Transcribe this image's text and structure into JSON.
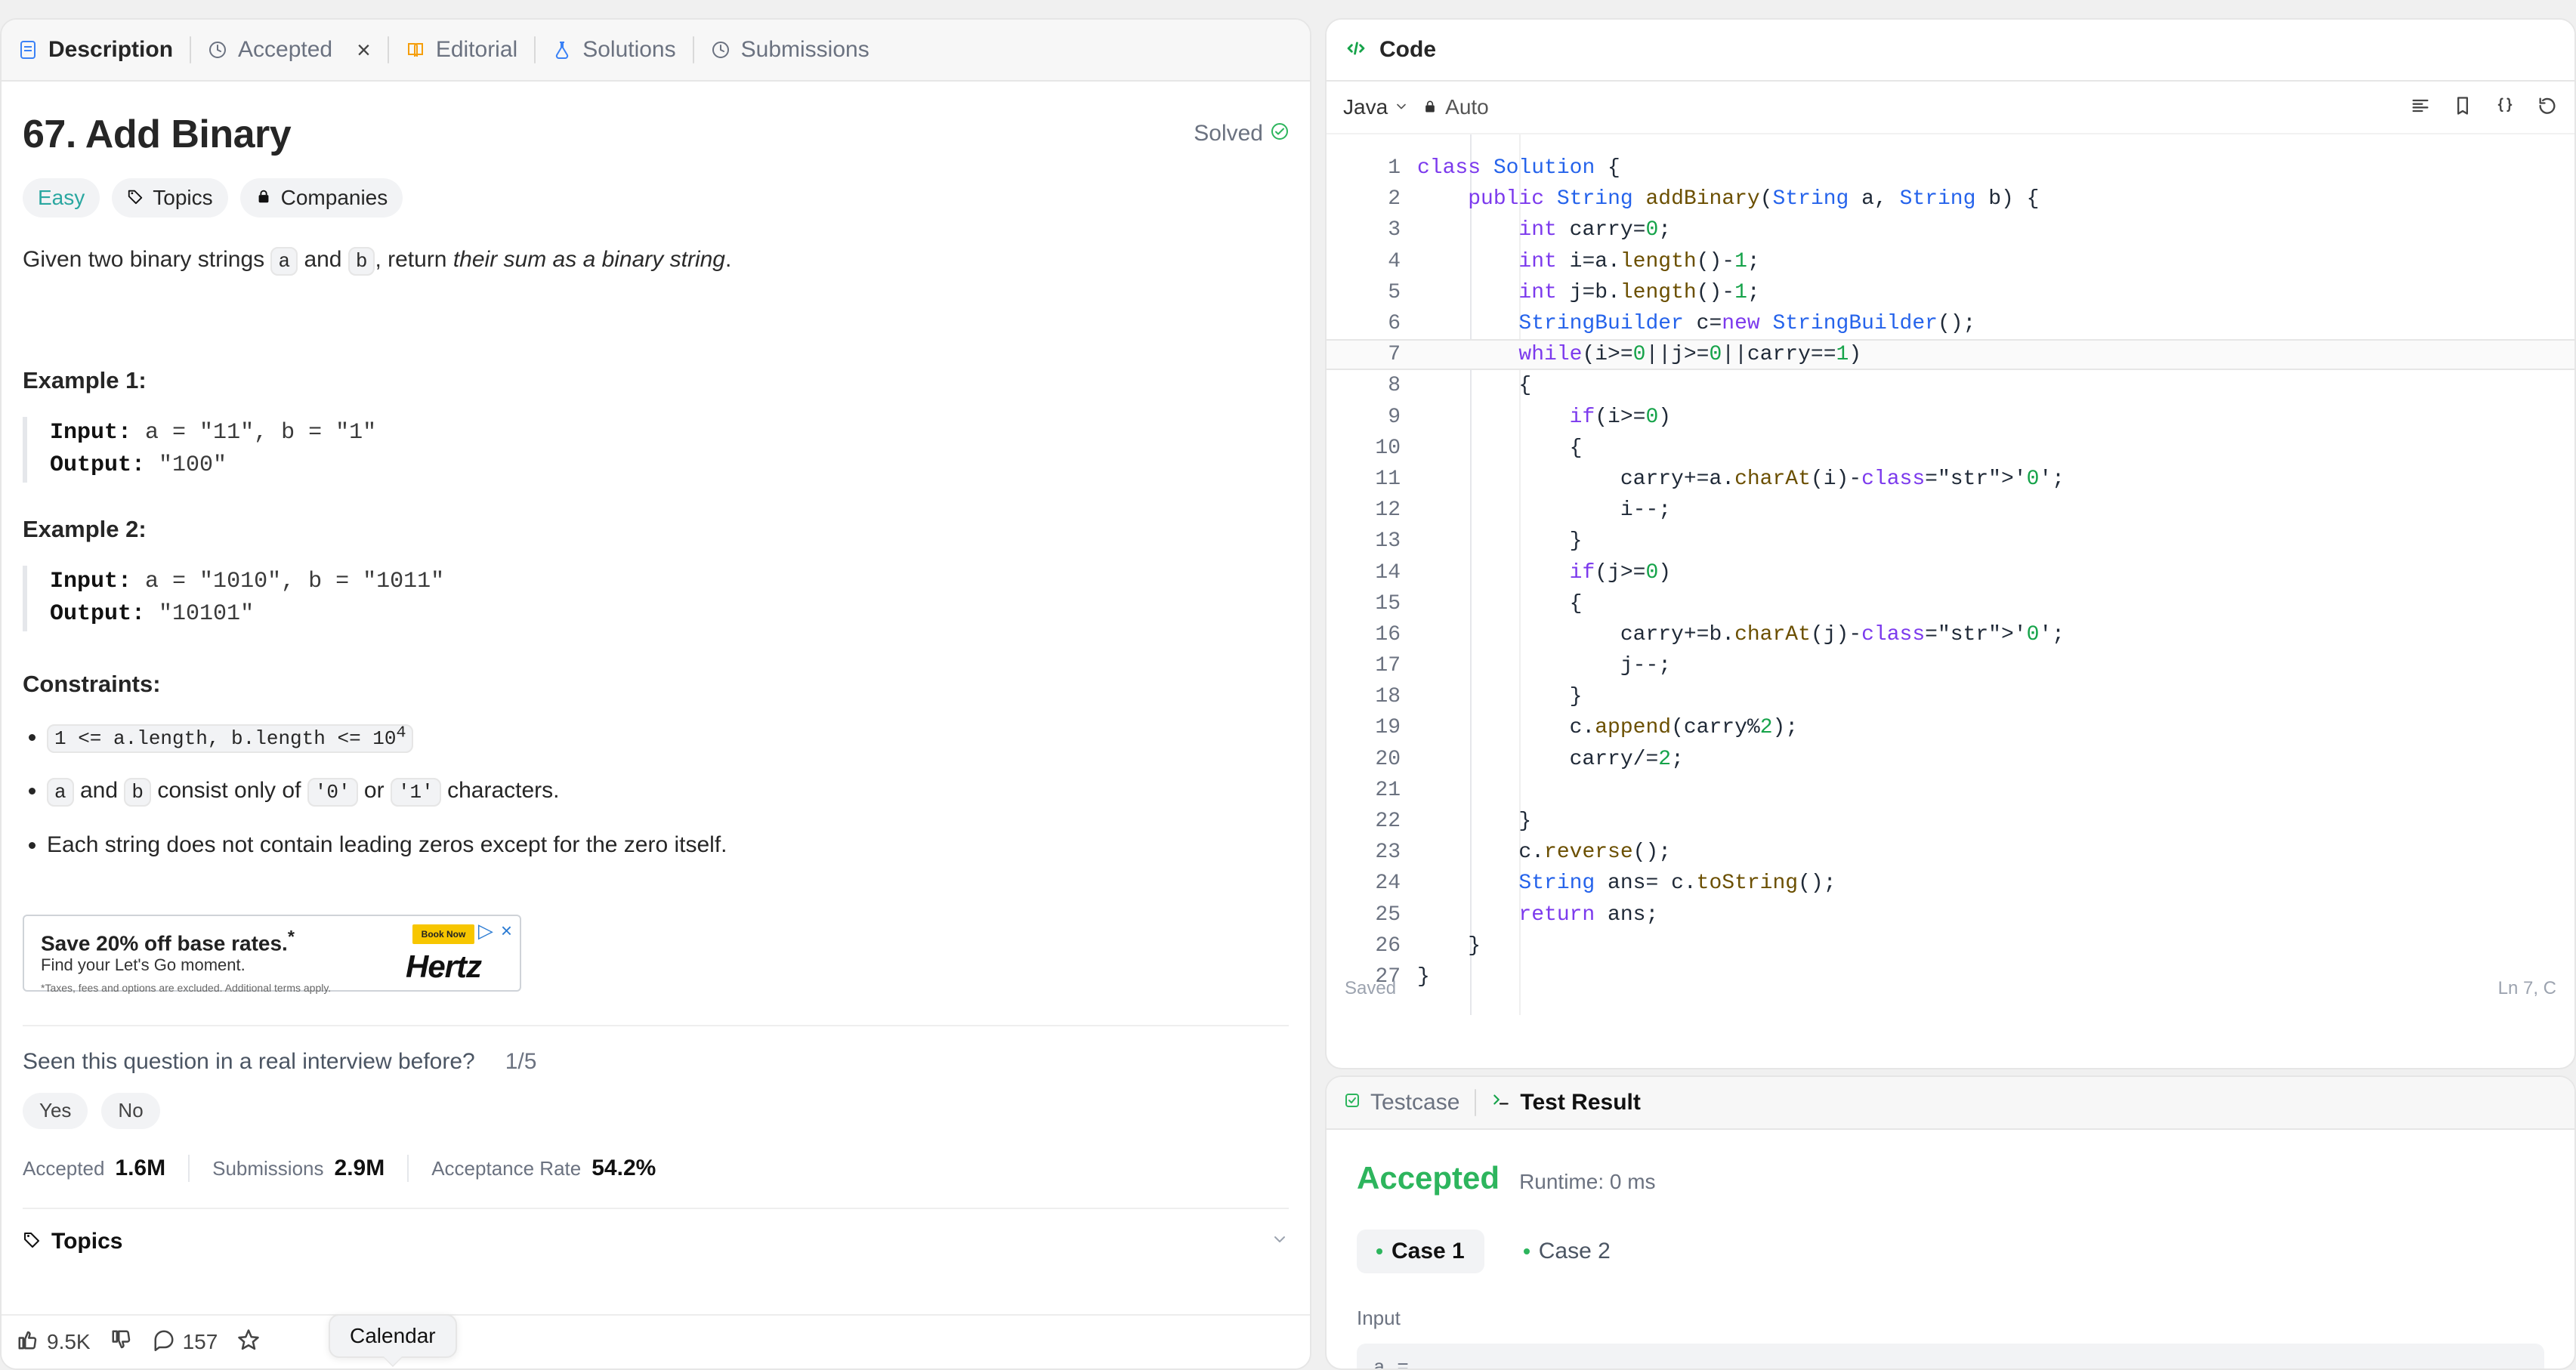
{
  "left": {
    "tabs": [
      "Description",
      "Accepted",
      "Editorial",
      "Solutions",
      "Submissions"
    ],
    "problem": {
      "title": "67. Add Binary",
      "status": "Solved",
      "difficulty": "Easy",
      "chips": [
        "Topics",
        "Companies"
      ],
      "description_prefix": "Given two binary strings",
      "a": "a",
      "and": "and",
      "b": "b",
      "description_mid": ", return",
      "description_em": "their sum as a binary string",
      "description_suffix": "."
    },
    "examples": [
      {
        "title": "Example 1:",
        "input_label": "Input:",
        "input_value": "a = \"11\", b = \"1\"",
        "output_label": "Output:",
        "output_value": "\"100\""
      },
      {
        "title": "Example 2:",
        "input_label": "Input:",
        "input_value": "a = \"1010\", b = \"1011\"",
        "output_label": "Output:",
        "output_value": "\"10101\""
      }
    ],
    "constraints": {
      "title": "Constraints:",
      "items": [
        {
          "code": "1 <= a.length, b.length <= 10",
          "sup": "4"
        },
        {
          "a": "a",
          "and": "and",
          "b": "b",
          "text": "consist only of",
          "c0": "'0'",
          "or": "or",
          "c1": "'1'",
          "end": "characters."
        },
        {
          "text": "Each string does not contain leading zeros except for the zero itself."
        }
      ]
    },
    "ad": {
      "line1": "Save 20% off base rates.",
      "line1_mark": "*",
      "line2": "Find your Let's Go moment.",
      "small": "*Taxes, fees and options are excluded. Additional terms apply.",
      "book": "Book Now",
      "brand": "Hertz"
    },
    "interview": {
      "question": "Seen this question in a real interview before?",
      "count": "1/5",
      "yes": "Yes",
      "no": "No"
    },
    "stats": {
      "accepted_label": "Accepted",
      "accepted_value": "1.6M",
      "submissions_label": "Submissions",
      "submissions_value": "2.9M",
      "rate_label": "Acceptance Rate",
      "rate_value": "54.2%"
    },
    "topics_row_label": "Topics",
    "bottom": {
      "likes": "9.5K",
      "comments": "157",
      "tooltip": "Calendar"
    }
  },
  "code": {
    "header": "Code",
    "language": "Java",
    "mode": "Auto",
    "lines": [
      "class Solution {",
      "    public String addBinary(String a, String b) {",
      "        int carry=0;",
      "        int i=a.length()-1;",
      "        int j=b.length()-1;",
      "        StringBuilder c=new StringBuilder();",
      "        while(i>=0||j>=0||carry==1)",
      "        {",
      "            if(i>=0)",
      "            {",
      "                carry+=a.charAt(i)-'0';",
      "                i--;",
      "            }",
      "            if(j>=0)",
      "            {",
      "                carry+=b.charAt(j)-'0';",
      "                j--;",
      "            }",
      "            c.append(carry%2);",
      "            carry/=2;",
      "",
      "        }",
      "        c.reverse();",
      "        String ans= c.toString();",
      "        return ans;",
      "    }",
      "}"
    ],
    "saved": "Saved",
    "cursor": "Ln 7, C"
  },
  "bottomPanel": {
    "tabs": [
      "Testcase",
      "Test Result"
    ],
    "result": "Accepted",
    "runtime": "Runtime: 0 ms",
    "cases": [
      "Case 1",
      "Case 2"
    ],
    "input_label": "Input",
    "input_preview": "a ="
  }
}
